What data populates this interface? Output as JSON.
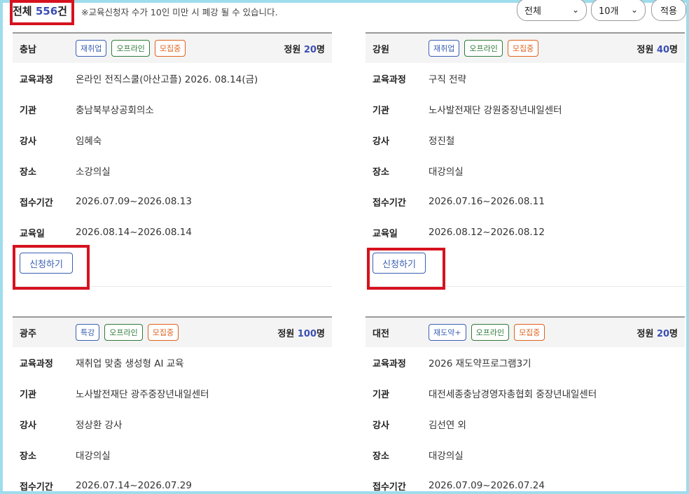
{
  "summary": {
    "total_prefix": "전체",
    "total_count": "556",
    "total_suffix": "건",
    "notice": "※교육신청자 수가 10인 미만 시 폐강 될 수 있습니다."
  },
  "filters": {
    "region_select": "전체",
    "page_size_select": "10개",
    "apply_label": "적용"
  },
  "labels": {
    "quota_prefix": "정원",
    "quota_suffix": "명",
    "course": "교육과정",
    "org": "기관",
    "instructor": "강사",
    "place": "장소",
    "reception": "접수기간",
    "edu_date": "교육일",
    "apply_button": "신청하기"
  },
  "cards": [
    {
      "region": "충남",
      "badges": [
        "재취업",
        "오프라인",
        "모집중"
      ],
      "quota": "20",
      "course": "온라인 전직스쿨(아산고플) 2026. 08.14(금)",
      "org": "충남북부상공회의소",
      "instructor": "임혜숙",
      "place": "소강의실",
      "reception": "2026.07.09~2026.08.13",
      "edu_date": "2026.08.14~2026.08.14"
    },
    {
      "region": "강원",
      "badges": [
        "재취업",
        "오프라인",
        "모집중"
      ],
      "quota": "40",
      "course": "구직 전략",
      "org": "노사발전재단 강원중장년내일센터",
      "instructor": "정진철",
      "place": "대강의실",
      "reception": "2026.07.16~2026.08.11",
      "edu_date": "2026.08.12~2026.08.12"
    },
    {
      "region": "광주",
      "badges": [
        "특강",
        "오프라인",
        "모집중"
      ],
      "quota": "100",
      "course": "재취업 맞춤 생성형 AI 교육",
      "org": "노사발전재단 광주중장년내일센터",
      "instructor": "정상환 강사",
      "place": "대강의실",
      "reception": "2026.07.14~2026.07.29"
    },
    {
      "region": "대전",
      "badges": [
        "재도약+",
        "오프라인",
        "모집중"
      ],
      "quota": "20",
      "course": "2026 재도약프로그램3기",
      "org": "대전세종충남경영자총협회 중장년내일센터",
      "instructor": "김선연 외",
      "place": "대강의실",
      "reception": "2026.07.09~2026.07.24"
    }
  ]
}
